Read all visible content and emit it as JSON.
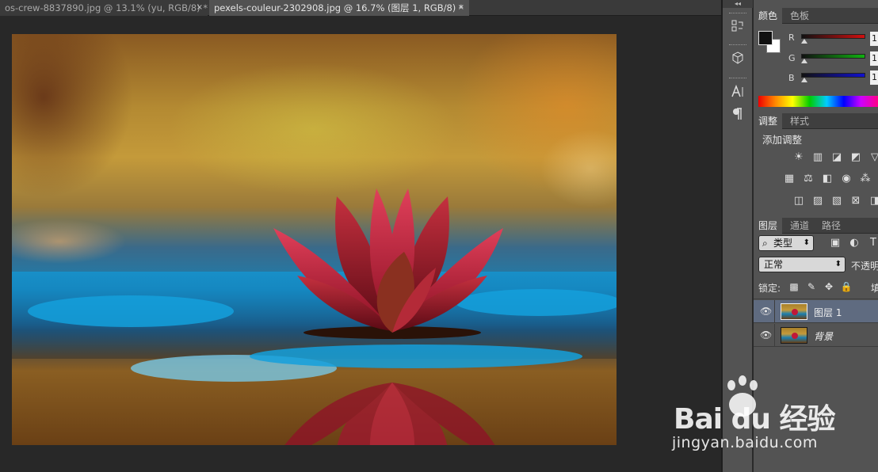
{
  "tabs": [
    {
      "label": "os-crew-8837890.jpg @ 13.1% (yu, RGB/8) *",
      "close": "×",
      "active": false
    },
    {
      "label": "pexels-couleur-2302908.jpg @ 16.7% (图层 1, RGB/8) *",
      "close": "×",
      "active": true
    }
  ],
  "dock": {
    "collapse": "◂◂"
  },
  "color_panel": {
    "tabs": [
      "颜色",
      "色板"
    ],
    "channels": [
      {
        "label": "R",
        "value": "1",
        "color": "#d01010"
      },
      {
        "label": "G",
        "value": "1",
        "color": "#10b010"
      },
      {
        "label": "B",
        "value": "1",
        "color": "#1010d0"
      }
    ],
    "foreground": "#111111",
    "background": "#ffffff"
  },
  "adjust_panel": {
    "tabs": [
      "调整",
      "样式"
    ],
    "title": "添加调整"
  },
  "layers_panel": {
    "tabs": [
      "图层",
      "通道",
      "路径"
    ],
    "filter_label": "类型",
    "blend_mode": "正常",
    "opacity_label": "不透明",
    "lock_label": "锁定:",
    "fill_label": "填",
    "layers": [
      {
        "name": "图层 1",
        "selected": true,
        "visible_icon": "👁"
      },
      {
        "name": "背景",
        "selected": false,
        "visible_icon": "👁"
      }
    ]
  },
  "watermark": {
    "logo": "Bai du 经验",
    "url": "jingyan.baidu.com"
  }
}
